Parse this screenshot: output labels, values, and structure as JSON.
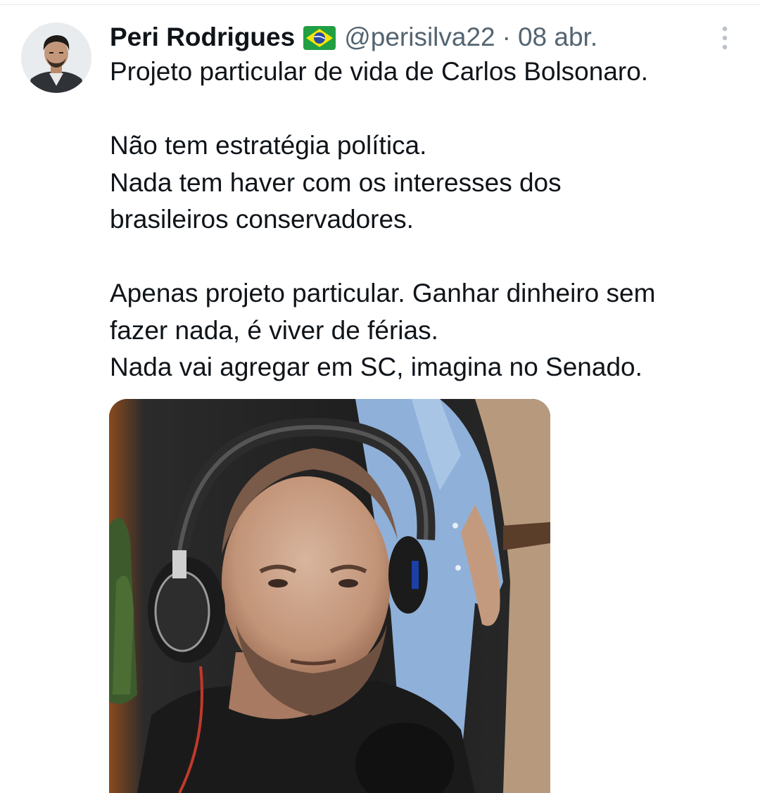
{
  "tweet": {
    "author": {
      "display_name": "Peri Rodrigues",
      "flag_icon": "brazil-flag-emoji",
      "handle": "@perisilva22",
      "separator": "·",
      "date": "08 abr."
    },
    "more_icon": "vertical-ellipsis-icon",
    "body": {
      "line1": "Projeto particular de vida de Carlos Bolsonaro.",
      "line2": "Não tem estratégia política.",
      "line3": "Nada tem haver com os interesses dos",
      "line4": "brasileiros conservadores.",
      "line5": "Apenas projeto particular. Ganhar dinheiro sem",
      "line6": "fazer nada, é viver de férias.",
      "line7": "Nada vai agregar em SC, imagina no Senado."
    },
    "media": {
      "type": "video-thumbnail"
    }
  },
  "colors": {
    "text_primary": "#0f1419",
    "text_secondary": "#536471",
    "divider": "#e6ecf0"
  }
}
